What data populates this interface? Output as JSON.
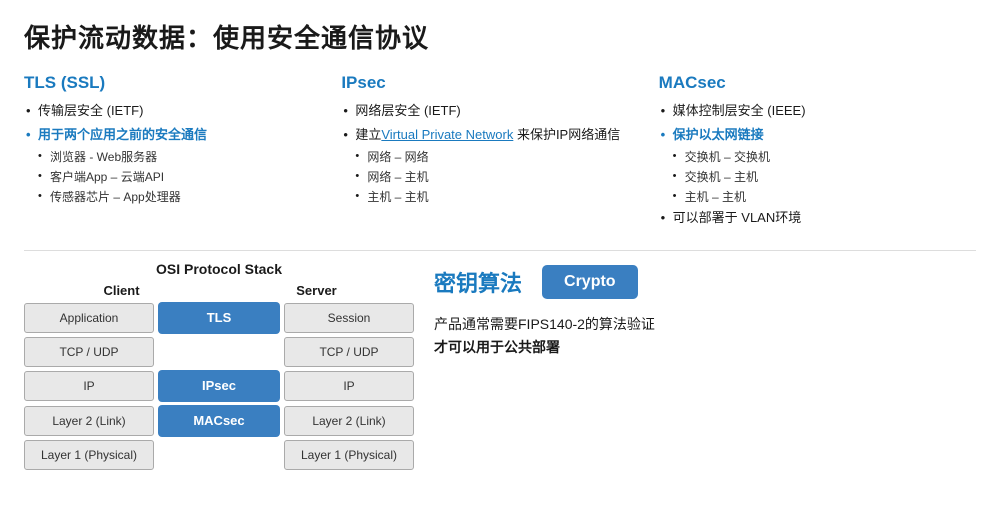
{
  "title": "保护流动数据：使用安全通信协议",
  "tls": {
    "heading": "TLS (SSL)",
    "items": [
      {
        "text": "传输层安全 (IETF)",
        "type": "normal"
      },
      {
        "text": "用于两个应用之前的安全通信",
        "type": "highlight"
      },
      {
        "text": "浏览器 - Web服务器",
        "type": "sub"
      },
      {
        "text": "客户端App – 云端API",
        "type": "sub"
      },
      {
        "text": "传感器芯片 – App处理器",
        "type": "sub"
      }
    ]
  },
  "ipsec": {
    "heading": "IPsec",
    "items": [
      {
        "text": "网络层安全 (IETF)",
        "type": "normal"
      },
      {
        "text": "建立",
        "link": "Virtual Private Network",
        "suffix": " 来保护IP网络通信",
        "type": "link"
      },
      {
        "text": "网络 – 网络",
        "type": "sub"
      },
      {
        "text": "网络 – 主机",
        "type": "sub"
      },
      {
        "text": "主机 – 主机",
        "type": "sub"
      }
    ]
  },
  "macsec": {
    "heading": "MACsec",
    "items": [
      {
        "text": "媒体控制层安全 (IEEE)",
        "type": "normal"
      },
      {
        "text": "保护以太网链接",
        "type": "highlight"
      },
      {
        "text": "交换机 – 交换机",
        "type": "sub"
      },
      {
        "text": "交换机 – 主机",
        "type": "sub"
      },
      {
        "text": "主机 – 主机",
        "type": "sub"
      },
      {
        "text": "可以部署于 VLAN环境",
        "type": "normal"
      }
    ]
  },
  "osi": {
    "title": "OSI  Protocol Stack",
    "client_label": "Client",
    "server_label": "Server",
    "rows": [
      {
        "client": "Application",
        "protocol": "TLS",
        "server": "Session",
        "has_protocol": true
      },
      {
        "client": "TCP / UDP",
        "protocol": null,
        "server": "TCP / UDP",
        "has_protocol": false
      },
      {
        "client": "IP",
        "protocol": "IPsec",
        "server": "IP",
        "has_protocol": true
      },
      {
        "client": "Layer 2 (Link)",
        "protocol": "MACsec",
        "server": "Layer 2 (Link)",
        "has_protocol": true
      },
      {
        "client": "Layer 1 (Physical)",
        "protocol": null,
        "server": "Layer 1 (Physical)",
        "has_protocol": false
      }
    ]
  },
  "crypto": {
    "title": "密钥算法",
    "button_label": "Crypto",
    "description_line1": "产品通常需要FIPS140-2的算法验证",
    "description_line2": "才可以用于公共部署"
  }
}
